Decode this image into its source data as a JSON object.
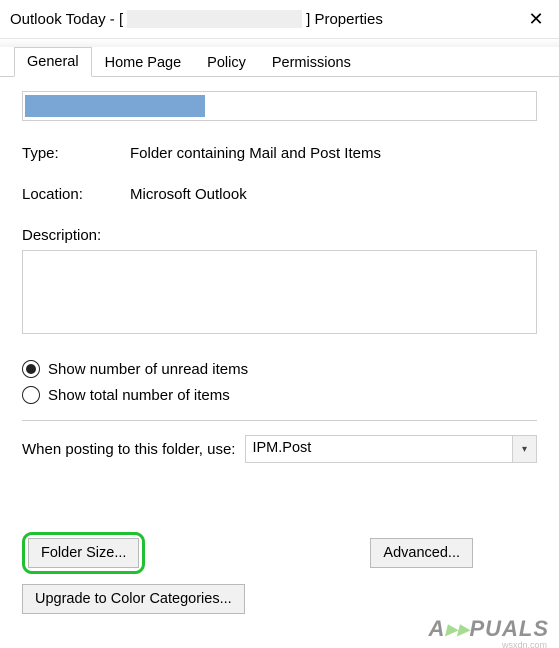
{
  "title": {
    "prefix": "Outlook Today - [",
    "suffix": "] Properties"
  },
  "closeGlyph": "✕",
  "tabs": {
    "general": "General",
    "homePage": "Home Page",
    "policy": "Policy",
    "permissions": "Permissions"
  },
  "fields": {
    "typeLabel": "Type:",
    "typeValue": "Folder containing Mail and Post Items",
    "locationLabel": "Location:",
    "locationValue": "Microsoft Outlook",
    "descriptionLabel": "Description:"
  },
  "radios": {
    "unread": "Show number of unread items",
    "total": "Show total number of items"
  },
  "posting": {
    "label": "When posting to this folder, use:",
    "value": "IPM.Post",
    "arrow": "▾"
  },
  "buttons": {
    "folderSize": "Folder Size...",
    "advanced": "Advanced...",
    "upgrade": "Upgrade to Color Categories..."
  },
  "watermark": {
    "text": "A  PUALS",
    "sub": "wsxdn.com"
  }
}
